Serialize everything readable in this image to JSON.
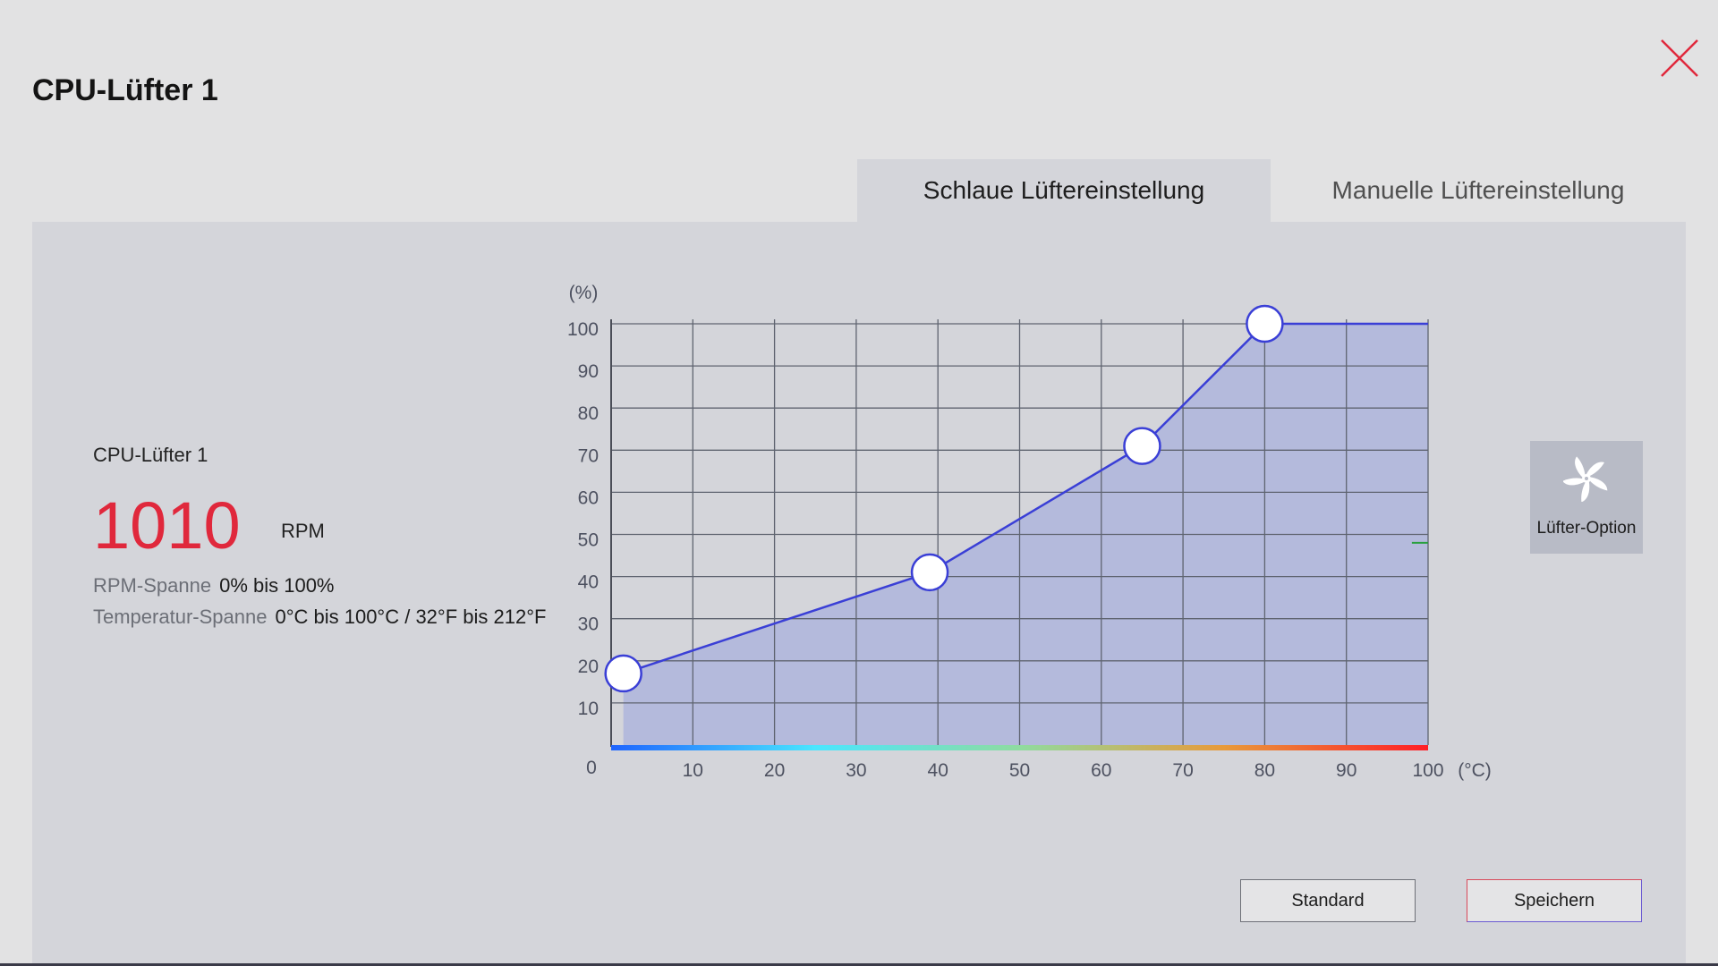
{
  "window": {
    "title": "CPU-Lüfter 1",
    "close_icon": "close-icon",
    "accent": "#e0283c"
  },
  "tabs": [
    {
      "label": "Schlaue Lüftereinstellung",
      "active": true
    },
    {
      "label": "Manuelle Lüftereinstellung",
      "active": false
    }
  ],
  "fan_info": {
    "name": "CPU-Lüfter 1",
    "rpm": "1010",
    "rpm_unit": "RPM",
    "rpm_range_label": "RPM-Spanne",
    "rpm_range_value": "0% bis 100%",
    "temp_range_label": "Temperatur-Spanne",
    "temp_range_value": "0°C bis 100°C / 32°F bis 212°F"
  },
  "chart_data": {
    "type": "line",
    "ylabel": "(%)",
    "xlabel": "(°C)",
    "xlim": [
      0,
      100
    ],
    "ylim": [
      0,
      100
    ],
    "x_ticks": [
      10,
      20,
      30,
      40,
      50,
      60,
      70,
      80,
      90,
      100
    ],
    "y_ticks": [
      10,
      20,
      30,
      40,
      50,
      60,
      70,
      80,
      90,
      100
    ],
    "origin_label": "0",
    "grid": true,
    "line_color": "#3a3fd6",
    "fill_color": "#aab0dc",
    "points": [
      {
        "x": 1.5,
        "y": 17
      },
      {
        "x": 39,
        "y": 41
      },
      {
        "x": 65,
        "y": 71
      },
      {
        "x": 80,
        "y": 100
      },
      {
        "x": 100,
        "y": 100
      }
    ],
    "handles": [
      0,
      1,
      2,
      3
    ],
    "current_marker": {
      "x": 99,
      "y": 48,
      "color": "#2aa040"
    },
    "gradient_colors": [
      "#1e64ff",
      "#4ae6ff",
      "#8fdca0",
      "#e89a3a",
      "#ff1e28"
    ]
  },
  "fan_option": {
    "label": "Lüfter-Option",
    "icon": "fan-icon"
  },
  "buttons": {
    "standard": "Standard",
    "save": "Speichern"
  }
}
